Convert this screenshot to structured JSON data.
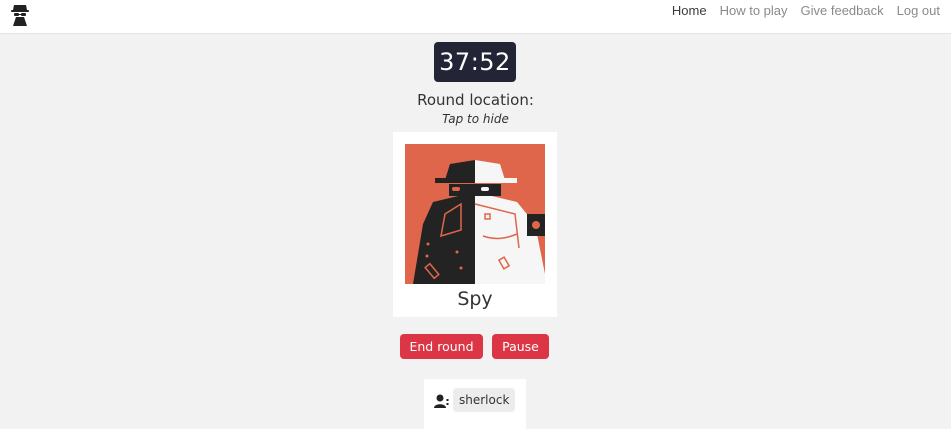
{
  "nav": {
    "links": [
      {
        "label": "Home",
        "active": true
      },
      {
        "label": "How to play"
      },
      {
        "label": "Give feedback"
      },
      {
        "label": "Log out"
      }
    ]
  },
  "game": {
    "timer": "37:52",
    "round_location_label": "Round location:",
    "tap_hint": "Tap to hide",
    "location_name": "Spy",
    "end_round_label": "End round",
    "pause_label": "Pause"
  },
  "players": {
    "icon": "user-icon",
    "list": [
      "sherlock"
    ]
  },
  "colors": {
    "timer_bg": "#232536",
    "danger": "#dc3545",
    "spy_bg": "#e0664b",
    "page_bg": "#f2f2f2"
  }
}
